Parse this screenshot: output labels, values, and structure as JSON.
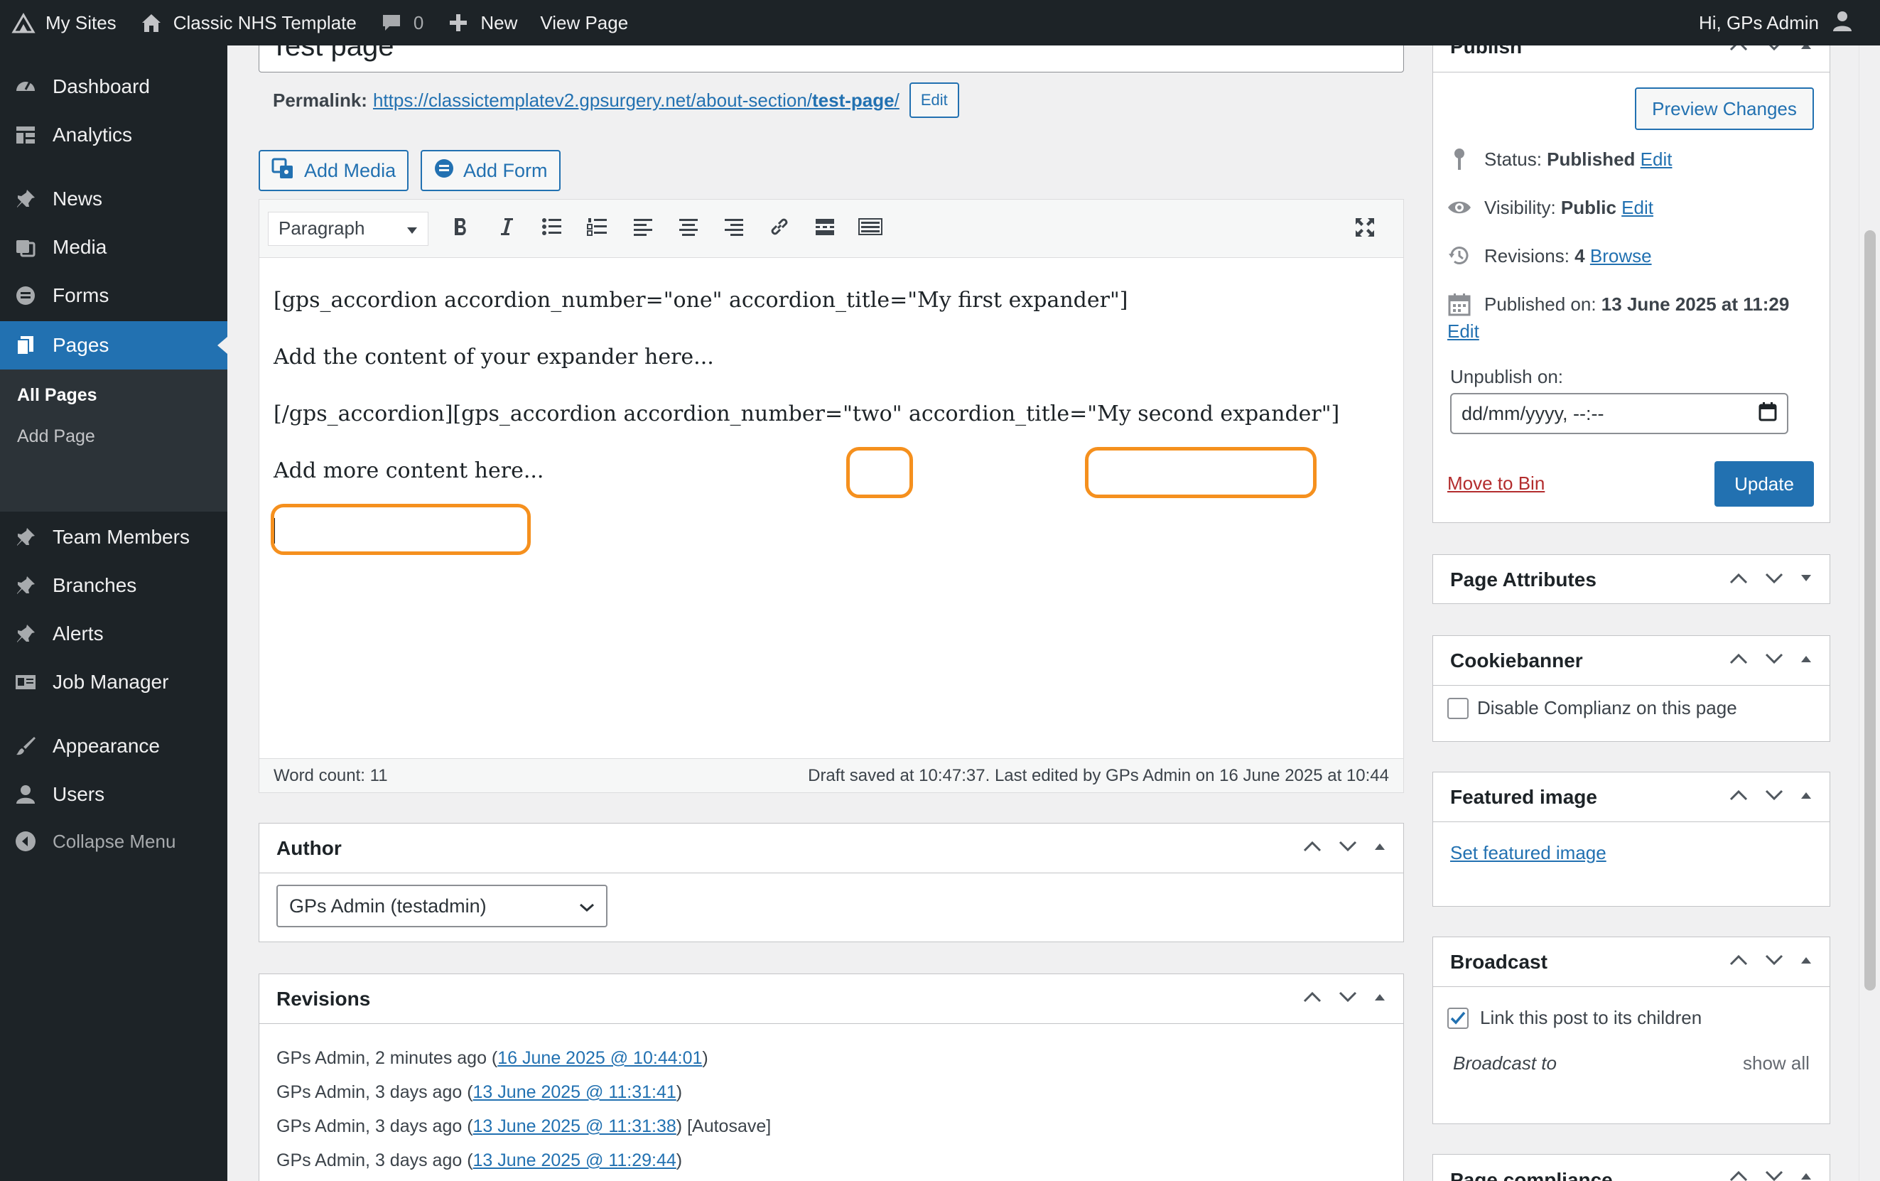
{
  "adminbar": {
    "my_sites": "My Sites",
    "site_name": "Classic NHS Template",
    "comments_count": "0",
    "new_label": "New",
    "view_page": "View Page",
    "greeting": "Hi, GPs Admin"
  },
  "sidebar": {
    "items": [
      {
        "label": "Dashboard"
      },
      {
        "label": "Analytics"
      },
      {
        "label": "News"
      },
      {
        "label": "Media"
      },
      {
        "label": "Forms"
      },
      {
        "label": "Pages"
      },
      {
        "label": "Team Members"
      },
      {
        "label": "Branches"
      },
      {
        "label": "Alerts"
      },
      {
        "label": "Job Manager"
      },
      {
        "label": "Appearance"
      },
      {
        "label": "Users"
      },
      {
        "label": "Collapse Menu"
      }
    ],
    "submenu": [
      "All Pages",
      "Add Page"
    ]
  },
  "editor": {
    "title": "Test page",
    "permalink_label": "Permalink:",
    "permalink_base": "https://classictemplatev2.gpsurgery.net/about-section/",
    "permalink_slug": "test-page",
    "permalink_end": "/",
    "permalink_edit": "Edit",
    "add_media": "Add Media",
    "add_form": "Add Form",
    "format": "Paragraph",
    "lines": [
      "[gps_accordion accordion_number=\"one\" accordion_title=\"My first expander\"]",
      "Add the content of your expander here...",
      "[/gps_accordion][gps_accordion accordion_number=\"two\" accordion_title=\"My second expander\"]",
      "Add more content here..."
    ],
    "word_count": "Word count: 11",
    "draft_status": "Draft saved at 10:47:37. Last edited by GPs Admin on 16 June 2025 at 10:44"
  },
  "author": {
    "title": "Author",
    "selected": "GPs Admin (testadmin)"
  },
  "revisions": {
    "title": "Revisions",
    "items": [
      {
        "prefix": "GPs Admin, 2 minutes ago (",
        "link": "16 June 2025 @ 10:44:01",
        "suffix": ")"
      },
      {
        "prefix": "GPs Admin, 3 days ago (",
        "link": "13 June 2025 @ 11:31:41",
        "suffix": ")"
      },
      {
        "prefix": "GPs Admin, 3 days ago (",
        "link": "13 June 2025 @ 11:31:38",
        "suffix": ") [Autosave]"
      },
      {
        "prefix": "GPs Admin, 3 days ago (",
        "link": "13 June 2025 @ 11:29:44",
        "suffix": ")"
      }
    ]
  },
  "publish": {
    "title": "Publish",
    "preview": "Preview Changes",
    "status_label": "Status:",
    "status_value": "Published",
    "visibility_label": "Visibility:",
    "visibility_value": "Public",
    "revisions_label": "Revisions:",
    "revisions_value": "4",
    "browse": "Browse",
    "published_label": "Published on:",
    "published_value": "13 June 2025 at 11:29",
    "edit": "Edit",
    "unpublish_label": "Unpublish on:",
    "unpublish_placeholder": "dd/mm/yyyy, --:--",
    "move_to_bin": "Move to Bin",
    "update": "Update"
  },
  "page_attributes": {
    "title": "Page Attributes"
  },
  "cookiebanner": {
    "title": "Cookiebanner",
    "checkbox_label": "Disable Complianz on this page"
  },
  "featured_image": {
    "title": "Featured image",
    "link": "Set featured image"
  },
  "broadcast": {
    "title": "Broadcast",
    "checkbox_label": "Link this post to its children",
    "broadcast_to": "Broadcast to",
    "show_all": "show all"
  },
  "page_compliance": {
    "title": "Page compliance"
  },
  "colors": {
    "accent": "#2271b1",
    "highlight": "#f5901e",
    "sidebar": "#1d2327"
  }
}
